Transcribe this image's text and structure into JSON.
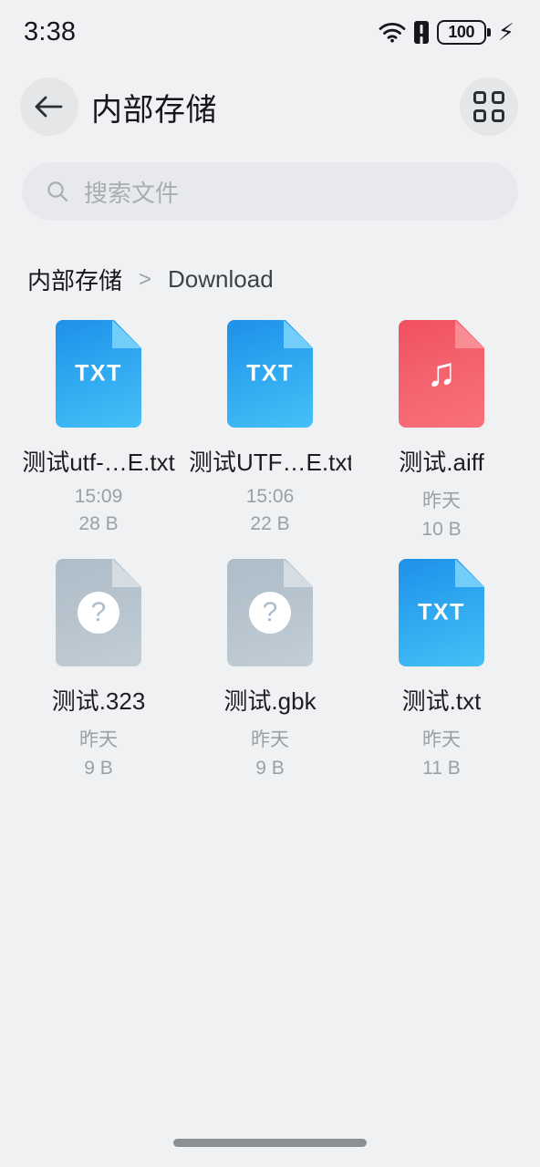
{
  "status_bar": {
    "time": "3:38",
    "battery_percent": "100",
    "icons": [
      "wifi-icon",
      "sim-alert-icon",
      "battery-icon",
      "charging-bolt-icon"
    ]
  },
  "header": {
    "title": "内部存储",
    "back_icon": "back-arrow-icon",
    "view_toggle_icon": "grid-view-icon"
  },
  "search": {
    "placeholder": "搜索文件",
    "value": "",
    "icon": "search-icon"
  },
  "breadcrumb": {
    "root": "内部存储",
    "separator": ">",
    "current": "Download"
  },
  "files": [
    {
      "name": "测试utf-…E.txt",
      "time": "15:09",
      "size": "28 B",
      "type": "txt",
      "icon_label": "TXT"
    },
    {
      "name": "测试UTF…E.txt",
      "time": "15:06",
      "size": "22 B",
      "type": "txt",
      "icon_label": "TXT"
    },
    {
      "name": "测试.aiff",
      "time": "昨天",
      "size": "10 B",
      "type": "audio",
      "icon_label": "♫"
    },
    {
      "name": "测试.323",
      "time": "昨天",
      "size": "9 B",
      "type": "unknown",
      "icon_label": "?"
    },
    {
      "name": "测试.gbk",
      "time": "昨天",
      "size": "9 B",
      "type": "unknown",
      "icon_label": "?"
    },
    {
      "name": "测试.txt",
      "time": "昨天",
      "size": "11 B",
      "type": "txt",
      "icon_label": "TXT"
    }
  ],
  "colors": {
    "background": "#f0f1f3",
    "txt_icon": "#2ea7f0",
    "audio_icon": "#f4636f",
    "unknown_icon": "#b7c4ce",
    "text_primary": "#15171a",
    "text_secondary": "#9aa0a6"
  }
}
